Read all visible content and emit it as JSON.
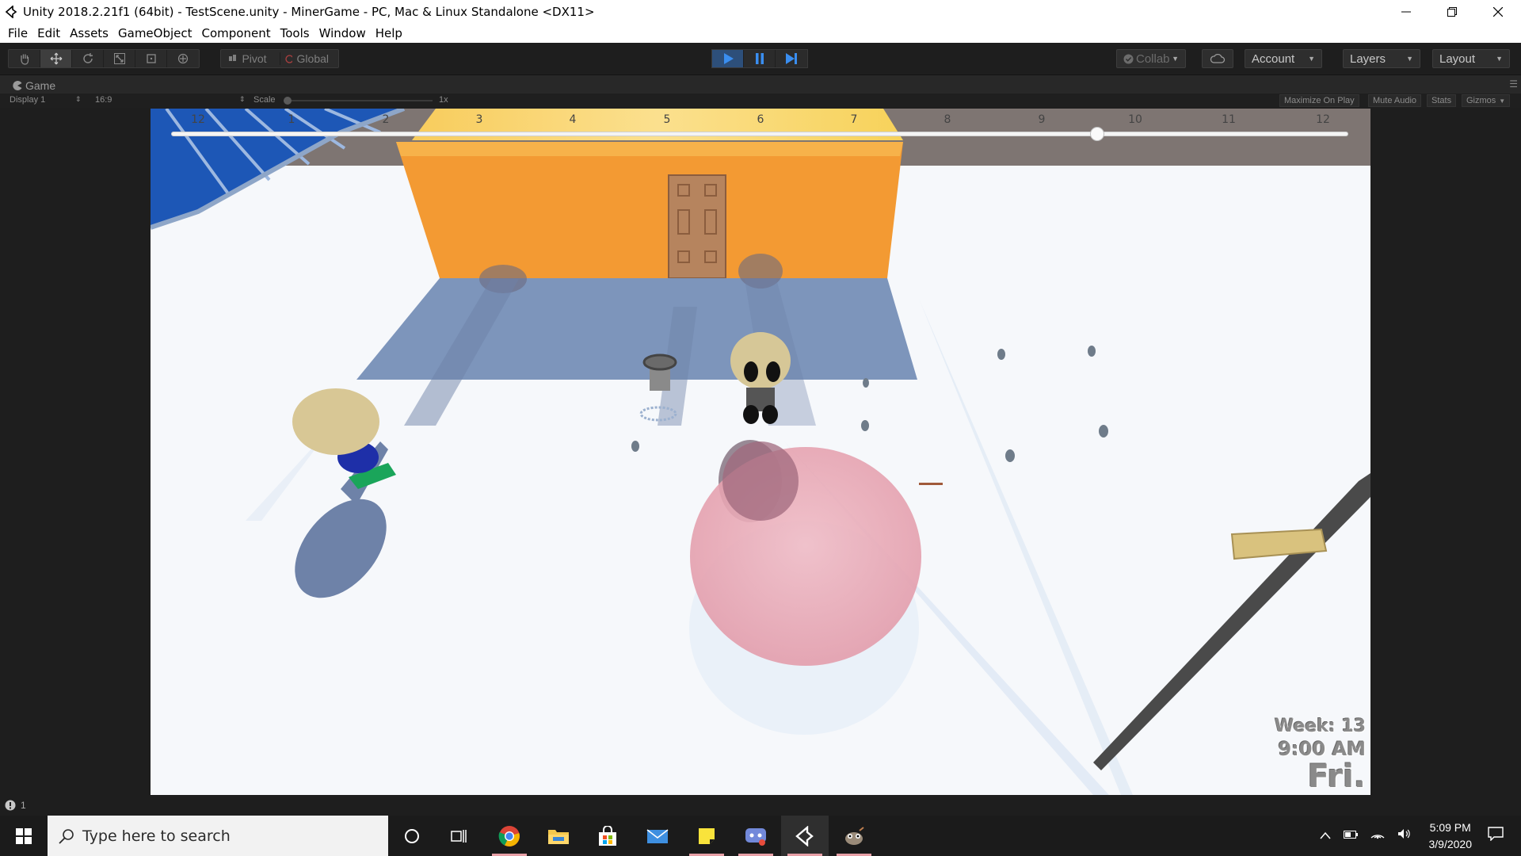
{
  "window": {
    "title": "Unity 2018.2.21f1 (64bit) - TestScene.unity - MinerGame - PC, Mac & Linux Standalone <DX11>"
  },
  "menu": [
    "File",
    "Edit",
    "Assets",
    "GameObject",
    "Component",
    "Tools",
    "Window",
    "Help"
  ],
  "toolbar": {
    "pivot_label": "Pivot",
    "global_label": "Global",
    "collab_label": "Collab",
    "account_label": "Account",
    "layers_label": "Layers",
    "layout_label": "Layout"
  },
  "game_tab": {
    "tab_label": "Game",
    "display_label": "Display 1",
    "aspect_label": "16:9",
    "scale_label": "Scale",
    "scale_value": "1x",
    "maximize_label": "Maximize On Play",
    "mute_label": "Mute Audio",
    "stats_label": "Stats",
    "gizmos_label": "Gizmos"
  },
  "timeline": {
    "ticks": [
      "12",
      "1",
      "2",
      "3",
      "4",
      "5",
      "6",
      "7",
      "8",
      "9",
      "10",
      "11",
      "12"
    ],
    "slider_value_fraction": 0.787
  },
  "hud": {
    "week": "Week: 13",
    "time": "9:00 AM",
    "day": "Fri."
  },
  "status": {
    "count": "1"
  },
  "taskbar": {
    "search_placeholder": "Type here to search",
    "time": "5:09 PM",
    "date": "3/9/2020"
  },
  "colors": {
    "unity_dark": "#1e1e1e",
    "play_blue": "#3a8ef0",
    "wall_orange": "#f39a33",
    "floor_shadow": "#7d95bb",
    "sphere_pink": "#e6a3b0"
  }
}
